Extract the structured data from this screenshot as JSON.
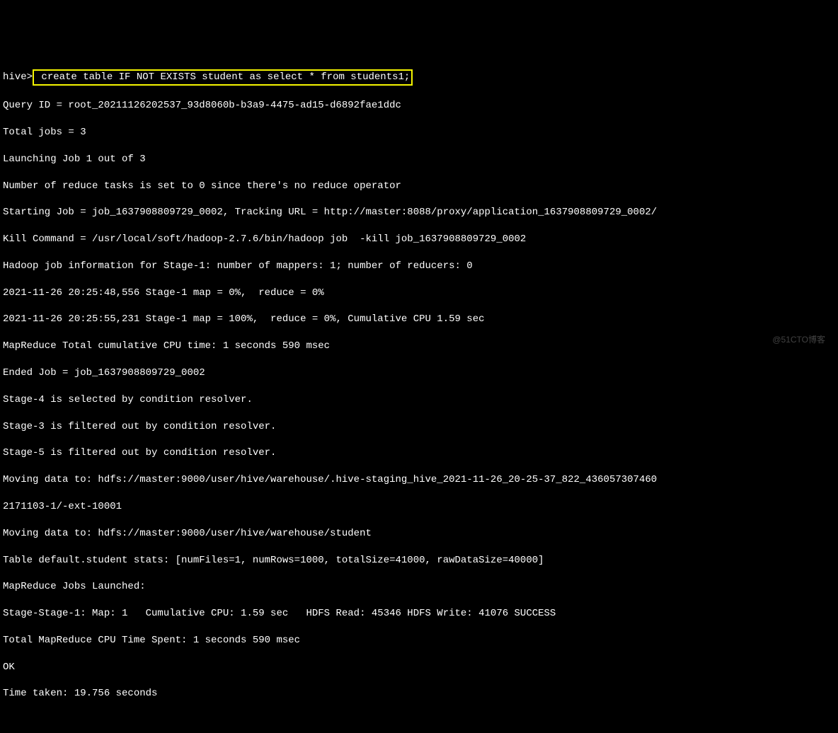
{
  "prompt": "hive>",
  "command": " create table IF NOT EXISTS student as select * from students1;",
  "lines": {
    "l1": "Query ID = root_20211126202537_93d8060b-b3a9-4475-ad15-d6892fae1ddc",
    "l2": "Total jobs = 3",
    "l3": "Launching Job 1 out of 3",
    "l4": "Number of reduce tasks is set to 0 since there's no reduce operator",
    "l5": "Starting Job = job_1637908809729_0002, Tracking URL = http://master:8088/proxy/application_1637908809729_0002/",
    "l6": "Kill Command = /usr/local/soft/hadoop-2.7.6/bin/hadoop job  -kill job_1637908809729_0002",
    "l7": "Hadoop job information for Stage-1: number of mappers: 1; number of reducers: 0",
    "l8": "2021-11-26 20:25:48,556 Stage-1 map = 0%,  reduce = 0%",
    "l9": "2021-11-26 20:25:55,231 Stage-1 map = 100%,  reduce = 0%, Cumulative CPU 1.59 sec",
    "l10": "MapReduce Total cumulative CPU time: 1 seconds 590 msec",
    "l11": "Ended Job = job_1637908809729_0002",
    "l12": "Stage-4 is selected by condition resolver.",
    "l13": "Stage-3 is filtered out by condition resolver.",
    "l14": "Stage-5 is filtered out by condition resolver.",
    "l15": "Moving data to: hdfs://master:9000/user/hive/warehouse/.hive-staging_hive_2021-11-26_20-25-37_822_436057307460",
    "l16": "2171103-1/-ext-10001",
    "l17": "Moving data to: hdfs://master:9000/user/hive/warehouse/student",
    "l18": "Table default.student stats: [numFiles=1, numRows=1000, totalSize=41000, rawDataSize=40000]",
    "l19": "MapReduce Jobs Launched:",
    "l20": "Stage-Stage-1: Map: 1   Cumulative CPU: 1.59 sec   HDFS Read: 45346 HDFS Write: 41076 SUCCESS",
    "l21": "Total MapReduce CPU Time Spent: 1 seconds 590 msec",
    "l22": "OK",
    "l23": "Time taken: 19.756 seconds"
  },
  "watermark": "@51CTO博客"
}
